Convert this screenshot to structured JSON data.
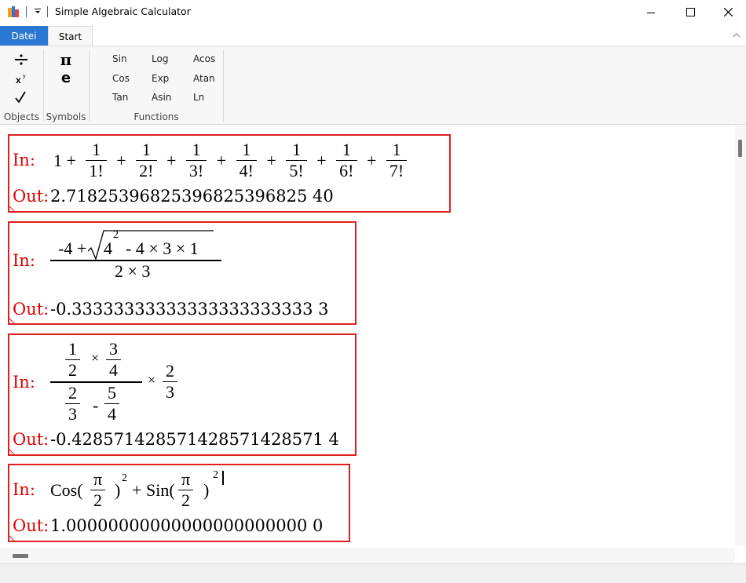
{
  "window": {
    "title": "Simple Algebraic Calculator",
    "qat_dropdown_icon": "qat-dropdown-icon",
    "controls": [
      "minimize-icon",
      "maximize-icon",
      "close-icon"
    ]
  },
  "ribbon": {
    "tabs": {
      "file": "Datei",
      "start": "Start"
    },
    "groups": {
      "objects": {
        "label": "Objects",
        "buttons": [
          "division-icon",
          "power-icon",
          "sqrt-icon"
        ]
      },
      "symbols": {
        "label": "Symbols",
        "buttons": {
          "pi": "π",
          "e": "e"
        }
      },
      "functions": {
        "label": "Functions",
        "items": [
          "Sin",
          "Cos",
          "Tan",
          "Log",
          "Exp",
          "Asin",
          "Acos",
          "Atan",
          "Ln"
        ]
      }
    }
  },
  "cells": {
    "in_label": "In:",
    "out_label": "Out:",
    "c1": {
      "lead": "1 +",
      "fracs": [
        {
          "num": "1",
          "den": "1!"
        },
        {
          "num": "1",
          "den": "2!"
        },
        {
          "num": "1",
          "den": "3!"
        },
        {
          "num": "1",
          "den": "4!"
        },
        {
          "num": "1",
          "den": "5!"
        },
        {
          "num": "1",
          "den": "6!"
        },
        {
          "num": "1",
          "den": "7!"
        }
      ],
      "plus": "+",
      "out": "2.71825396825396825396825 40"
    },
    "c2": {
      "num_left": "-4 +",
      "sqrt_content_base": "4",
      "sqrt_content_exp": "2",
      "sqrt_content_rest": "- 4 × 3 × 1",
      "den": "2 × 3",
      "out": "-0.33333333333333333333333 3"
    },
    "c3": {
      "a_num": "1",
      "a_den": "2",
      "b_num": "3",
      "b_den": "4",
      "c_num": "2",
      "c_den": "3",
      "d_num": "5",
      "d_den": "4",
      "e_num": "2",
      "e_den": "3",
      "times": "×",
      "minus": "-",
      "out": "-0.428571428571428571428571 4"
    },
    "c4": {
      "cos": "Cos(",
      "sin": "Sin(",
      "pi": "π",
      "two": "2",
      "close": ")",
      "exp": "2",
      "plus": "+",
      "out": "1.00000000000000000000000 0"
    }
  }
}
